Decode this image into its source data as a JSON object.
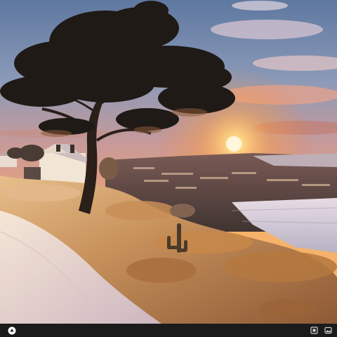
{
  "image": {
    "alt": "",
    "palette": {
      "sky_top": "#6f86a8",
      "sky_mid": "#c98a86",
      "horizon_glow": "#ffb65a",
      "frost": "#f2e4d2",
      "grass_warm": "#c9894a",
      "tree_dark": "#1f1a16"
    }
  },
  "bottom_bar": {
    "left_icon": "app-logo-icon",
    "right_icons": [
      "copy-icon",
      "image-icon"
    ],
    "background": "#1b1b1b"
  }
}
